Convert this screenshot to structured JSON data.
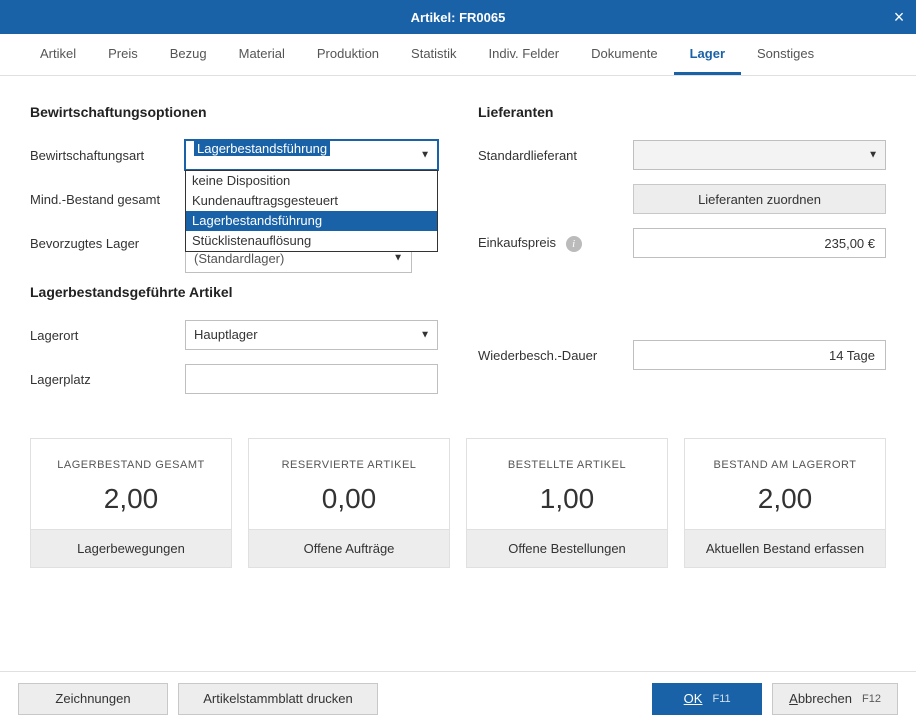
{
  "titlebar": {
    "title": "Artikel: FR0065"
  },
  "tabs": [
    "Artikel",
    "Preis",
    "Bezug",
    "Material",
    "Produktion",
    "Statistik",
    "Indiv. Felder",
    "Dokumente",
    "Lager",
    "Sonstiges"
  ],
  "active_tab": "Lager",
  "left": {
    "section1_title": "Bewirtschaftungsoptionen",
    "bewirtschaftungsart_label": "Bewirtschaftungsart",
    "bewirtschaftungsart_value": "Lagerbestandsführung",
    "bewirtschaftungsart_options": [
      "keine Disposition",
      "Kundenauftragsgesteuert",
      "Lagerbestandsführung",
      "Stücklistenauflösung"
    ],
    "mind_bestand_label": "Mind.-Bestand gesamt",
    "mind_bestand_value": "",
    "bevorzugtes_lager_label": "Bevorzugtes Lager",
    "bevorzugtes_lager_value": "(Standardlager)",
    "section2_title": "Lagerbestandsgeführte Artikel",
    "lagerort_label": "Lagerort",
    "lagerort_value": "Hauptlager",
    "lagerplatz_label": "Lagerplatz",
    "lagerplatz_value": ""
  },
  "right": {
    "section_title": "Lieferanten",
    "standardlieferant_label": "Standardlieferant",
    "standardlieferant_value": "",
    "zuordnen_label": "Lieferanten zuordnen",
    "einkaufspreis_label": "Einkaufspreis",
    "einkaufspreis_value": "235,00 €",
    "wiederbesch_label": "Wiederbesch.-Dauer",
    "wiederbesch_value": "14 Tage"
  },
  "cards": [
    {
      "label": "LAGERBESTAND GESAMT",
      "value": "2,00",
      "action": "Lagerbewegungen"
    },
    {
      "label": "RESERVIERTE ARTIKEL",
      "value": "0,00",
      "action": "Offene Aufträge"
    },
    {
      "label": "BESTELLTE ARTIKEL",
      "value": "1,00",
      "action": "Offene Bestellungen"
    },
    {
      "label": "BESTAND AM LAGERORT",
      "value": "2,00",
      "action": "Aktuellen Bestand erfassen"
    }
  ],
  "footer": {
    "zeichnungen": "Zeichnungen",
    "stamm": "Artikelstammblatt drucken",
    "ok": "OK",
    "ok_key": "F11",
    "cancel_pre": "A",
    "cancel_rest": "bbrechen",
    "cancel_key": "F12"
  }
}
